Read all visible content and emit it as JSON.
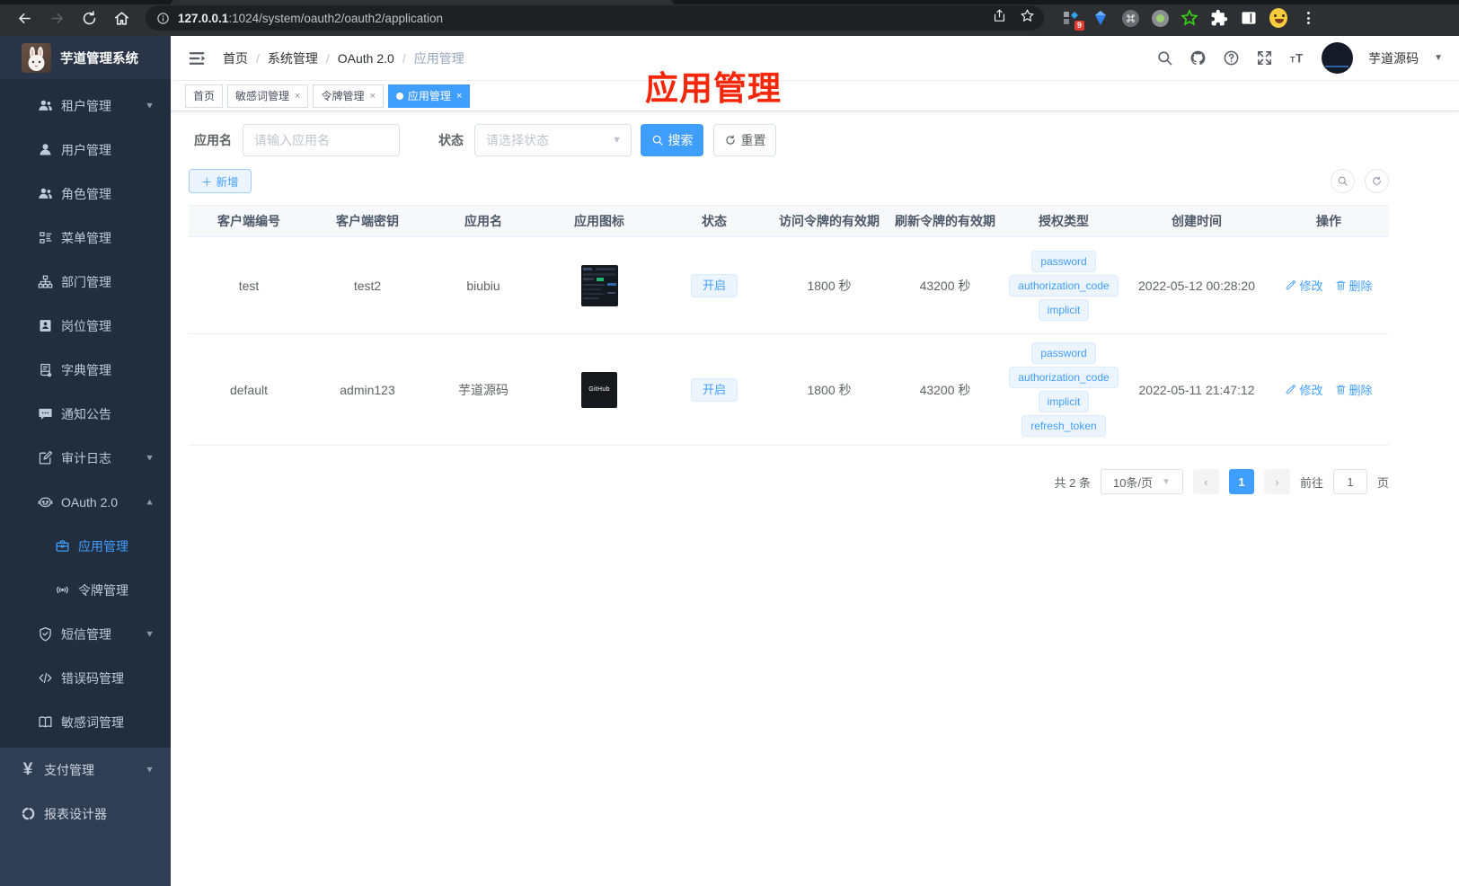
{
  "browser": {
    "url_host": "127.0.0.1",
    "url_rest": ":1024/system/oauth2/oauth2/application",
    "extension_badge": "9"
  },
  "sidebar": {
    "title": "芋道管理系统",
    "menu": [
      {
        "label": "租户管理"
      },
      {
        "label": "用户管理"
      },
      {
        "label": "角色管理"
      },
      {
        "label": "菜单管理"
      },
      {
        "label": "部门管理"
      },
      {
        "label": "岗位管理"
      },
      {
        "label": "字典管理"
      },
      {
        "label": "通知公告"
      },
      {
        "label": "审计日志"
      },
      {
        "label": "OAuth 2.0"
      },
      {
        "label": "应用管理"
      },
      {
        "label": "令牌管理"
      },
      {
        "label": "短信管理"
      },
      {
        "label": "错误码管理"
      },
      {
        "label": "敏感词管理"
      },
      {
        "label": "支付管理"
      },
      {
        "label": "报表设计器"
      }
    ]
  },
  "header": {
    "breadcrumb": [
      "首页",
      "系统管理",
      "OAuth 2.0",
      "应用管理"
    ],
    "username": "芋道源码"
  },
  "tabs": [
    {
      "label": "首页"
    },
    {
      "label": "敏感词管理"
    },
    {
      "label": "令牌管理"
    },
    {
      "label": "应用管理"
    }
  ],
  "annotation": {
    "text": "应用管理",
    "color": "#f5270b"
  },
  "filter": {
    "app_name_label": "应用名",
    "app_name_placeholder": "请输入应用名",
    "status_label": "状态",
    "status_placeholder": "请选择状态",
    "search_label": "搜索",
    "reset_label": "重置"
  },
  "toolbar": {
    "add_label": "新增"
  },
  "table": {
    "columns": [
      "客户端编号",
      "客户端密钥",
      "应用名",
      "应用图标",
      "状态",
      "访问令牌的有效期",
      "刷新令牌的有效期",
      "授权类型",
      "创建时间",
      "操作"
    ],
    "rows": [
      {
        "client_id": "test",
        "secret": "test2",
        "name": "biubiu",
        "status": "开启",
        "access_ttl": "1800 秒",
        "refresh_ttl": "43200 秒",
        "grant_types": [
          "password",
          "authorization_code",
          "implicit"
        ],
        "created": "2022-05-12 00:28:20",
        "edit_label": "修改",
        "delete_label": "删除"
      },
      {
        "client_id": "default",
        "secret": "admin123",
        "name": "芋道源码",
        "status": "开启",
        "access_ttl": "1800 秒",
        "refresh_ttl": "43200 秒",
        "grant_types": [
          "password",
          "authorization_code",
          "implicit",
          "refresh_token"
        ],
        "created": "2022-05-11 21:47:12",
        "icon_label": "GitHub",
        "edit_label": "修改",
        "delete_label": "删除"
      }
    ]
  },
  "pagination": {
    "total": "共 2 条",
    "page_size": "10条/页",
    "current": "1",
    "goto_label": "前往",
    "goto_value": "1",
    "page_label": "页"
  },
  "colors": {
    "primary": "#409EFF",
    "sidebar_bg": "#222d3d",
    "annotation": "#f5270b"
  }
}
